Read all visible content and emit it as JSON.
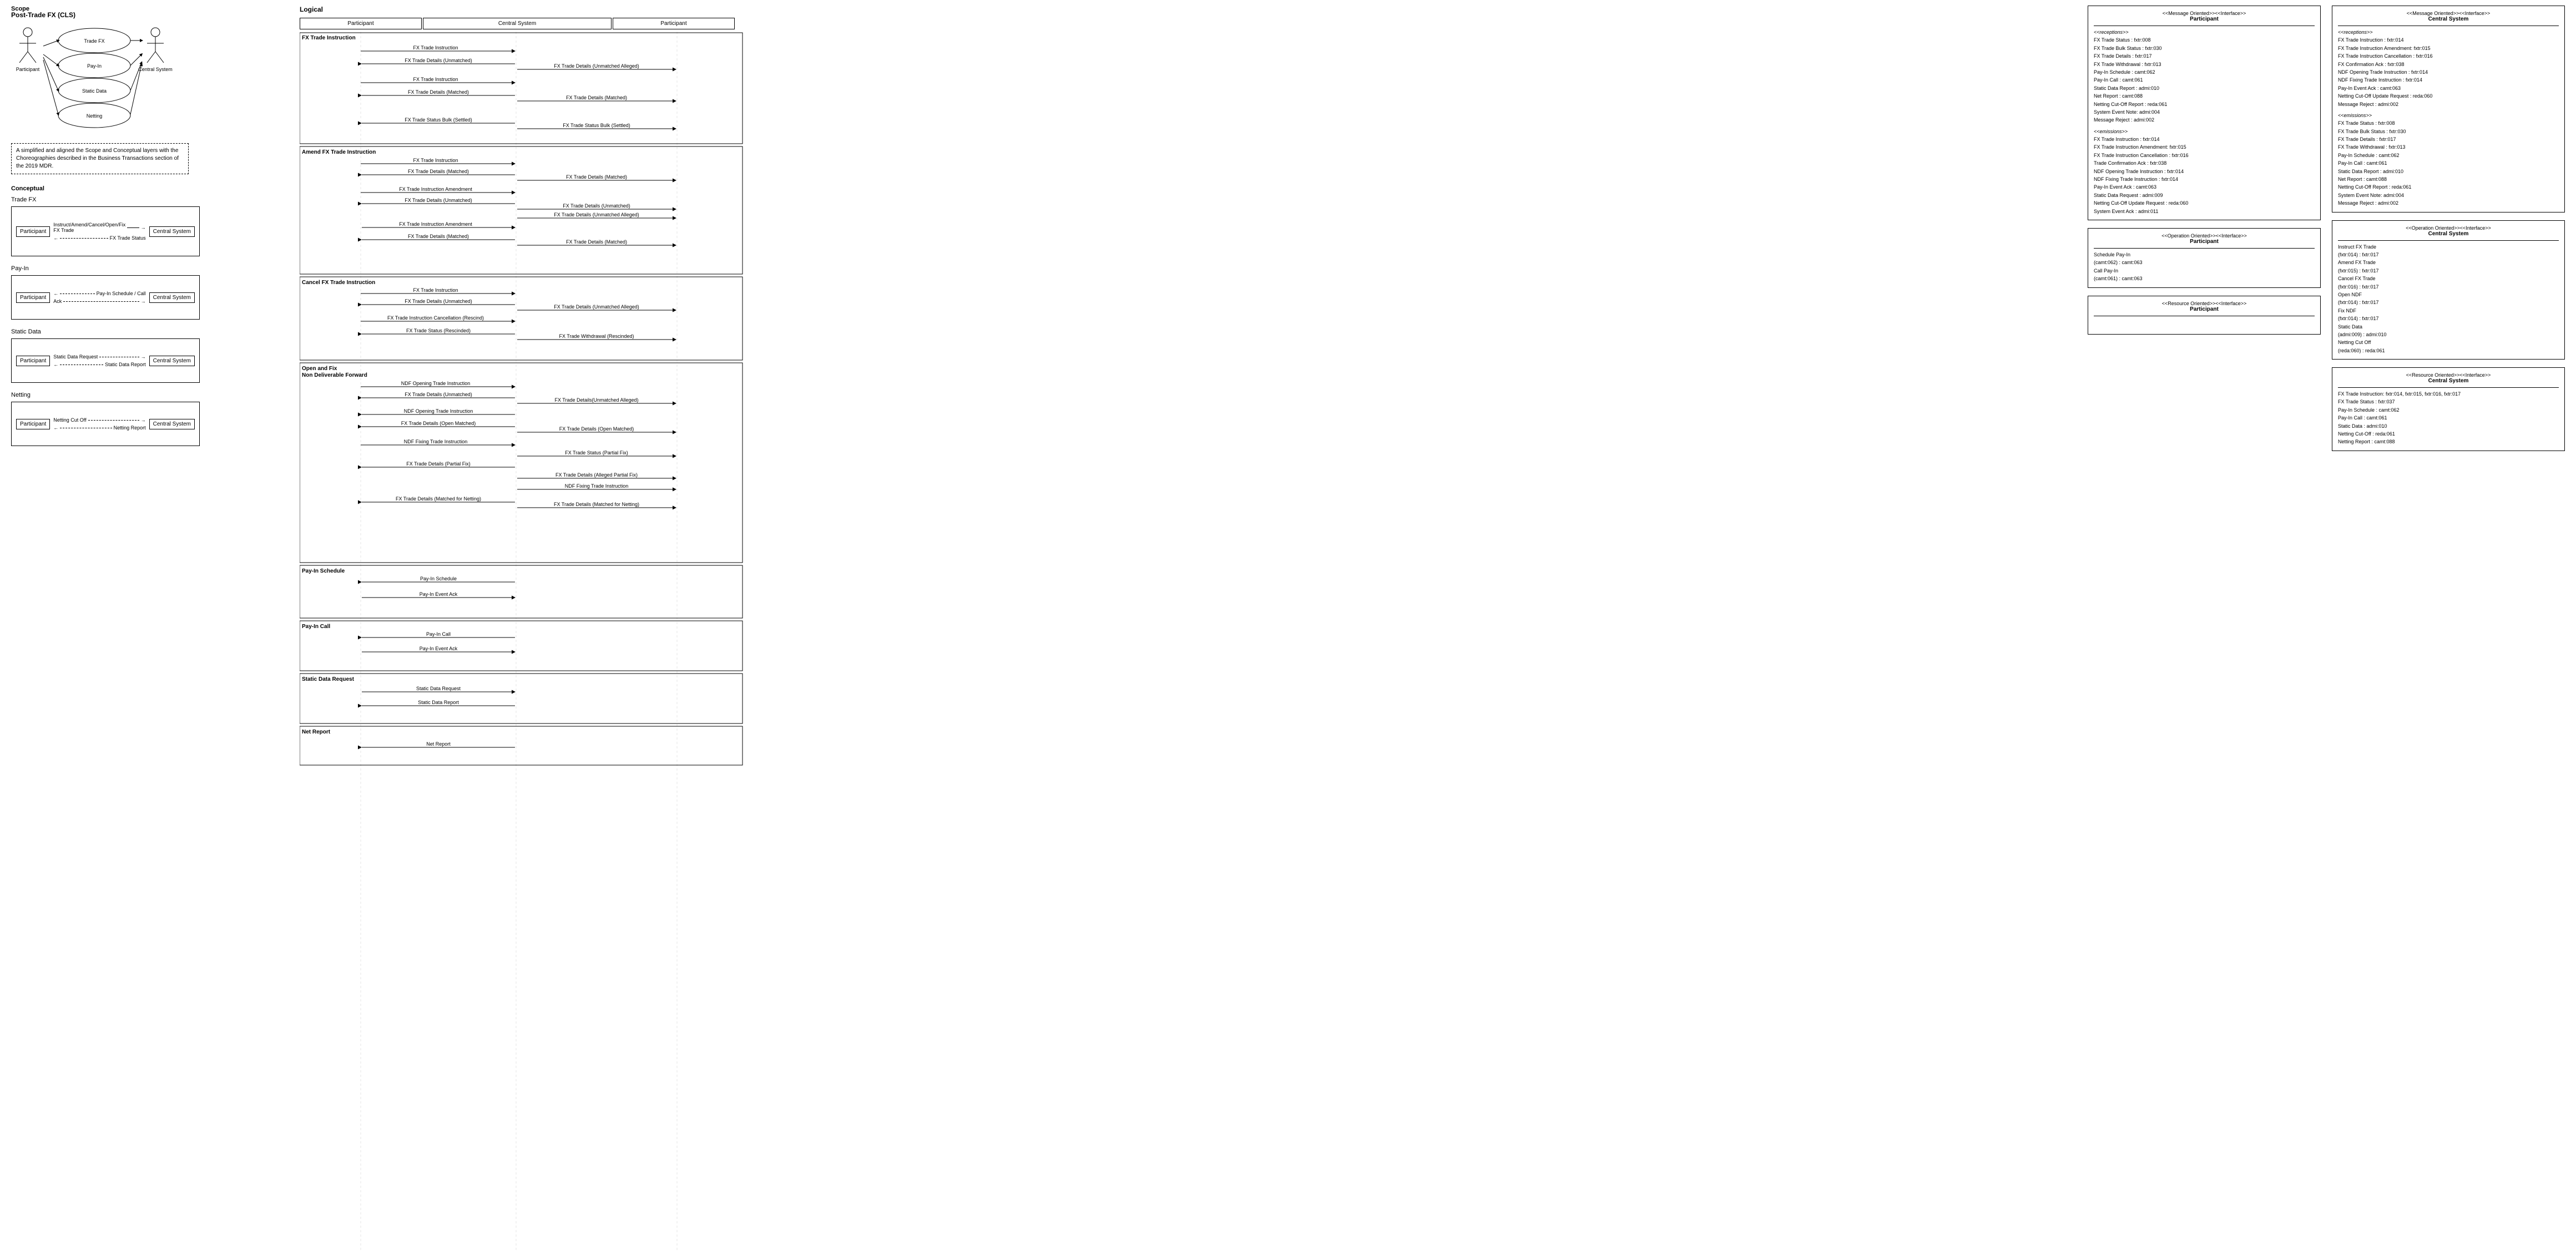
{
  "title": "Post-Trade FX (CLS)",
  "scope_label": "Scope",
  "scope_note": "A simplified and aligned the Scope and Conceptual layers with the Choreographies described in the Business Transactions section of the 2019 MDR.",
  "conceptual_label": "Conceptual",
  "logical_label": "Logical",
  "lanes": {
    "participant": "Participant",
    "central_system": "Central System",
    "participant2": "Participant"
  },
  "conceptual_groups": [
    {
      "title": "Trade FX",
      "arrows": [
        {
          "label": "Instruct/Amend/Cancel/Open/Fix FX Trade",
          "direction": "right",
          "style": "solid"
        },
        {
          "label": "FX Trade Status",
          "direction": "left",
          "style": "dashed"
        }
      ]
    },
    {
      "title": "Pay-In",
      "arrows": [
        {
          "label": "Pay-In Schedule / Call",
          "direction": "right",
          "style": "dashed"
        },
        {
          "label": "Ack",
          "direction": "left",
          "style": "dashed"
        }
      ]
    },
    {
      "title": "Static Data",
      "arrows": [
        {
          "label": "Static Data Request",
          "direction": "right",
          "style": "dashed"
        },
        {
          "label": "Static Data Report",
          "direction": "left",
          "style": "dashed"
        }
      ]
    },
    {
      "title": "Netting",
      "arrows": [
        {
          "label": "Netting Cut Off",
          "direction": "right",
          "style": "dashed"
        },
        {
          "label": "Netting Report",
          "direction": "left",
          "style": "dashed"
        }
      ]
    }
  ],
  "flow_groups": [
    {
      "id": "fx_trade_instruction",
      "title": "FX Trade Instruction",
      "flows": [
        {
          "from": "participant",
          "to": "central",
          "label": "FX Trade Instruction",
          "direction": "right"
        },
        {
          "from": "central",
          "to": "participant",
          "label": "FX Trade Details (Unmatched)",
          "direction": "left",
          "label2": "FX Trade Details (Unmatched Alleged)",
          "direction2": "right"
        },
        {
          "from": "participant",
          "to": "central",
          "label": "FX Trade Instruction",
          "direction": "right"
        },
        {
          "from": "central",
          "to": "participant",
          "label": "FX Trade Details (Matched)",
          "direction": "left",
          "label2": "FX Trade Details (Matched)",
          "direction2": "right"
        },
        {
          "from": "central",
          "to": "participant",
          "label": "FX Trade Status Bulk (Settled)",
          "direction": "left",
          "label2": "FX Trade Status Bulk (Settled)",
          "direction2": "right"
        }
      ]
    },
    {
      "id": "amend_fx",
      "title": "Amend FX Trade Instruction",
      "flows": [
        {
          "label": "FX Trade Instruction",
          "arrow": "right_to_central"
        },
        {
          "label": "FX Trade Details (Matched)",
          "arrow": "both",
          "label2": "FX Trade Details (Matched)"
        },
        {
          "label": "FX Trade Instruction Amendment",
          "arrow": "right_to_central"
        },
        {
          "label": "FX Trade Details (Unmatched)",
          "arrow": "left_from_central",
          "label2": "FX Trade Details (Unmatched)"
        },
        {
          "label": "FX Trade Details (Unmatched Alleged)",
          "arrow": "right_to_p2"
        },
        {
          "label": "FX Trade Details (Unmatched Alleged)",
          "arrow": "right_to_p2"
        },
        {
          "label": "FX Trade Instruction Amendment",
          "arrow": "right_to_central"
        },
        {
          "label": "FX Trade Details (Matched)",
          "arrow": "both",
          "label2": "FX Trade Details (Matched)"
        }
      ]
    },
    {
      "id": "cancel_fx",
      "title": "Cancel FX Trade Instruction",
      "flows": [
        {
          "label": "FX Trade Instruction",
          "arrow": "right"
        },
        {
          "label": "FX Trade Details (Unmatched)",
          "arrow": "left",
          "label2": "FX Trade Details (Unmatched Alleged)",
          "arrow2": "right"
        },
        {
          "label": "FX Trade Instruction Cancellation (Rescind)",
          "arrow": "right"
        },
        {
          "label": "FX Trade Status (Rescinded)",
          "arrow": "left",
          "label2": "FX Trade Withdrawal (Rescinded)",
          "arrow2": "right"
        }
      ]
    },
    {
      "id": "open_fix_ndf",
      "title": "Open and Fix Non Deliverable Forward",
      "flows": [
        {
          "label": "NDF Opening Trade Instruction",
          "arrow": "right"
        },
        {
          "label": "FX Trade Details (Unmatched)",
          "arrow": "left",
          "label2": "FX Trade Details(Unmatched Alleged)",
          "arrow2": "right"
        },
        {
          "label": "NDF Opening Trade Instruction",
          "arrow": "left"
        },
        {
          "label": "FX Trade Details (Open Matched)",
          "arrow": "left",
          "label2": "FX Trade Details (Open Matched)",
          "arrow2": "right"
        },
        {
          "label": "NDF Fixing Trade Instruction",
          "arrow": "right"
        },
        {
          "label": "FX Trade Status (Partial Fix)",
          "arrow": "right"
        },
        {
          "label": "FX Trade Details (Partial Fix)",
          "arrow": "left"
        },
        {
          "label": "FX Trade Details (Alleged Partial Fix)",
          "arrow": "right"
        },
        {
          "label": "NDF Fixing Trade Instruction",
          "arrow": "right"
        },
        {
          "label": "FX Trade Details (Matched for Netting)",
          "arrow": "left",
          "label2": "FX Trade Details (Matched for Netting)",
          "arrow2": "right"
        }
      ]
    },
    {
      "id": "pay_in_schedule",
      "title": "Pay-In Schedule",
      "flows": [
        {
          "label": "Pay-In Schedule",
          "arrow": "left"
        },
        {
          "label": "Pay-In Event Ack",
          "arrow": "right"
        }
      ]
    },
    {
      "id": "pay_in_call",
      "title": "Pay-In Call",
      "flows": [
        {
          "label": "Pay-In Call",
          "arrow": "left"
        },
        {
          "label": "Pay-In Event Ack",
          "arrow": "right"
        }
      ]
    },
    {
      "id": "static_data",
      "title": "Static Data Request",
      "flows": [
        {
          "label": "Static Data Request",
          "arrow": "right"
        },
        {
          "label": "Static Data Report",
          "arrow": "left"
        }
      ]
    },
    {
      "id": "net_report",
      "title": "Net Report",
      "flows": [
        {
          "label": "Net Report",
          "arrow": "left"
        }
      ]
    }
  ],
  "participant_msg_oriented": {
    "stereotype": "<<Message Oriented>><<Interface>>",
    "name": "Participant",
    "receptions_label": "<<receptions>>",
    "receptions": [
      "FX Trade Status : fxtr:008",
      "FX Trade Bulk Status : fxtr:030",
      "FX Trade Details : fxtr:017",
      "FX Trade Withdrawal : fxtr:013",
      "Pay-In Schedule : camt:062",
      "Pay-In Call : camt:061",
      "Static Data Report : admi:010",
      "Net Report : camt:088",
      "Netting Cut-Off Report : reda:061",
      "System Event Note: admi:004",
      "Message Reject : admi:002"
    ],
    "emissions_label": "<<emissions>>",
    "emissions": [
      "FX Trade Instruction : fxtr:014",
      "FX Trade Instruction Amendment: fxtr:015",
      "FX Trade Instruction Cancellation : fxtr:016",
      "Trade Confirmation Ack : fxtr:038",
      "NDF Opening Trade Instruction : fxtr:014",
      "NDF Fixing Trade Instruction : fxtr:014",
      "Pay-In Event Ack : camt:063",
      "Static Data Request : admi:009",
      "Netting Cut-Off Update Request : reda:060",
      "System Event Ack : admi:011"
    ]
  },
  "central_msg_oriented": {
    "stereotype": "<<Message Oriented>><<Interface>>",
    "name": "Central System",
    "receptions_label": "<<receptions>>",
    "receptions": [
      "FX Trade Instruction : fxtr:014",
      "FX Trade Instruction Amendment: fxtr:015",
      "FX Trade Instruction Cancellation : fxtr:016",
      "FX Confirmation Ack : fxtr:038",
      "NDF Opening Trade Instruction : fxtr:014",
      "NDF Fixing Trade Instruction : fxtr:014",
      "Pay-In Event Ack : camt:063",
      "Netting Cut-Off Update Request : reda:060",
      "Message Reject : admi:002"
    ],
    "emissions_label": "<<emissions>>",
    "emissions": [
      "FX Trade Status : fxtr:008",
      "FX Trade Bulk Status : fxtr:030",
      "FX Trade Details : fxtr:017",
      "FX Trade Withdrawal : fxtr:013",
      "Pay-In Schedule : camt:062",
      "Pay-In Call : camt:061",
      "Static Data Report : admi:010",
      "Net Report : camt:088",
      "Netting Cut-Off Report : reda:061",
      "System Event Note: admi:004",
      "Message Reject : admi:002"
    ]
  },
  "participant_op_oriented": {
    "stereotype": "<<Operation Oriented>><<Interface>>",
    "name": "Participant",
    "items": [
      "Schedule Pay-In",
      " (camt:062) : camt:063",
      "Call Pay-In",
      " (camt:061) : camt:063"
    ]
  },
  "central_op_oriented": {
    "stereotype": "<<Operation Oriented>><<Interface>>",
    "name": "Central System",
    "items": [
      "Instruct FX Trade",
      " (fxtr:014) : fxtr:017",
      "Amend FX Trade",
      " (fxtr:015) : fxtr:017",
      "Cancel FX Trade",
      " (fxtr:016) : fxtr:017",
      "Open NDF",
      " (fxtr:014) : fxtr:017",
      "Fix NDF",
      " (fxtr:014) : fxtr:017",
      "Static Data",
      " (admi:009) : admi:010",
      "Netting Cut Off",
      " (reda:060) : reda:061"
    ]
  },
  "participant_res_oriented": {
    "stereotype": "<<Resource Oriented>><<Interface>>",
    "name": "Participant",
    "items": []
  },
  "central_res_oriented": {
    "stereotype": "<<Resource Oriented>><<Interface>>",
    "name": "Central System",
    "items": [
      "FX Trade Instruction: fxtr:014, fxtr:015, fxtr:016, fxtr:017",
      "FX Trade Status : fxtr:037",
      "Pay-In Schedule : camt:062",
      "Pay-In Call : camt:061",
      "Static Data : admi:010",
      "Netting Cut-Off : reda:061",
      "Netting Report : camt:088"
    ]
  }
}
